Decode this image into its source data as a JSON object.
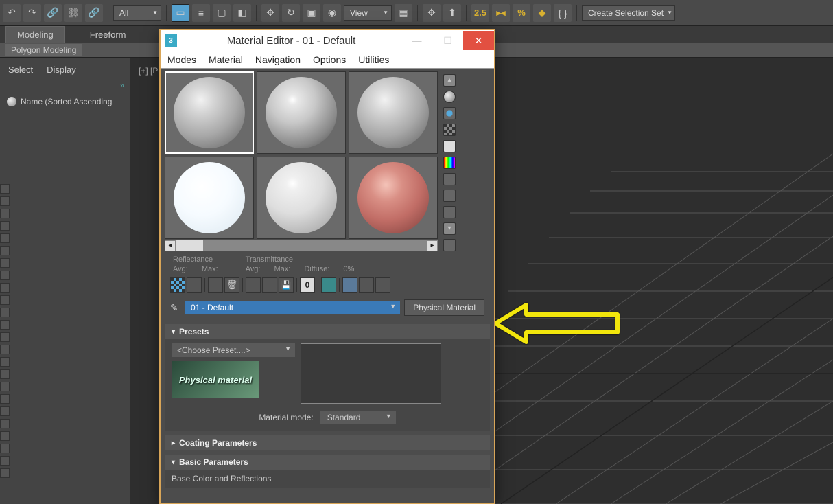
{
  "toolbar": {
    "all_dropdown": "All",
    "view_dropdown": "View",
    "create_set": "Create Selection Set",
    "two_five": "2.5",
    "percent": "%"
  },
  "tabs": {
    "modeling": "Modeling",
    "freeform": "Freeform"
  },
  "subbar": {
    "polygon": "Polygon Modeling"
  },
  "left": {
    "select": "Select",
    "display": "Display",
    "expand": "»",
    "sort_header": "Name (Sorted Ascending"
  },
  "viewport": {
    "label": "[+] [Pers"
  },
  "me": {
    "title": "Material Editor - 01 - Default",
    "minimize": "—",
    "maximize": "☐",
    "close": "✕",
    "menu": {
      "modes": "Modes",
      "material": "Material",
      "navigation": "Navigation",
      "options": "Options",
      "utilities": "Utilities"
    },
    "scroll_up": "▴",
    "scroll_down": "▾",
    "scroll_left": "◂",
    "scroll_right": "▸",
    "reflectance": "Reflectance",
    "transmittance": "Transmittance",
    "avg": "Avg:",
    "max": "Max:",
    "diffuse": "Diffuse:",
    "diffuse_val": "0%",
    "zero_btn": "0",
    "picker": "✎",
    "material_name": "01 - Default",
    "type_button": "Physical Material",
    "presets_header": "Presets",
    "choose_preset": "<Choose Preset....>",
    "thumb_text": "Physical material",
    "material_mode_label": "Material mode:",
    "material_mode_value": "Standard",
    "coating_header": "Coating Parameters",
    "basic_header": "Basic Parameters",
    "base_color_label": "Base Color and Reflections"
  }
}
